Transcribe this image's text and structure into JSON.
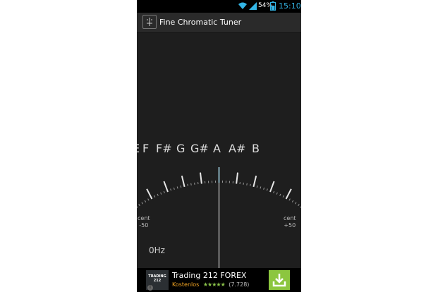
{
  "status_bar": {
    "battery_percent": "54%",
    "time": "15:10"
  },
  "action_bar": {
    "title": "Fine Chromatic Tuner",
    "app_icon": "tuner-app-icon"
  },
  "tuner": {
    "notes": [
      "E",
      "F",
      "F#",
      "G",
      "G#",
      "A",
      "A#",
      "B"
    ],
    "left_cent_label": "cent",
    "left_cent_value": "-50",
    "right_cent_label": "cent",
    "right_cent_value": "+50",
    "frequency": "0Hz",
    "needle_cents": 0
  },
  "ad": {
    "logo_text": "TRADING 212",
    "title": "Trading 212 FOREX",
    "subtitle": "Kostenlos",
    "stars": "★★★★★",
    "rating_count": "(7.728)",
    "download_icon": "download-icon",
    "info_icon": "info-icon"
  },
  "colors": {
    "time": "#33b5e5",
    "ad_download": "#8cc63f",
    "ad_free": "#f5a623",
    "needle": "#a8a8a8",
    "center_tick": "#33b5e5"
  }
}
